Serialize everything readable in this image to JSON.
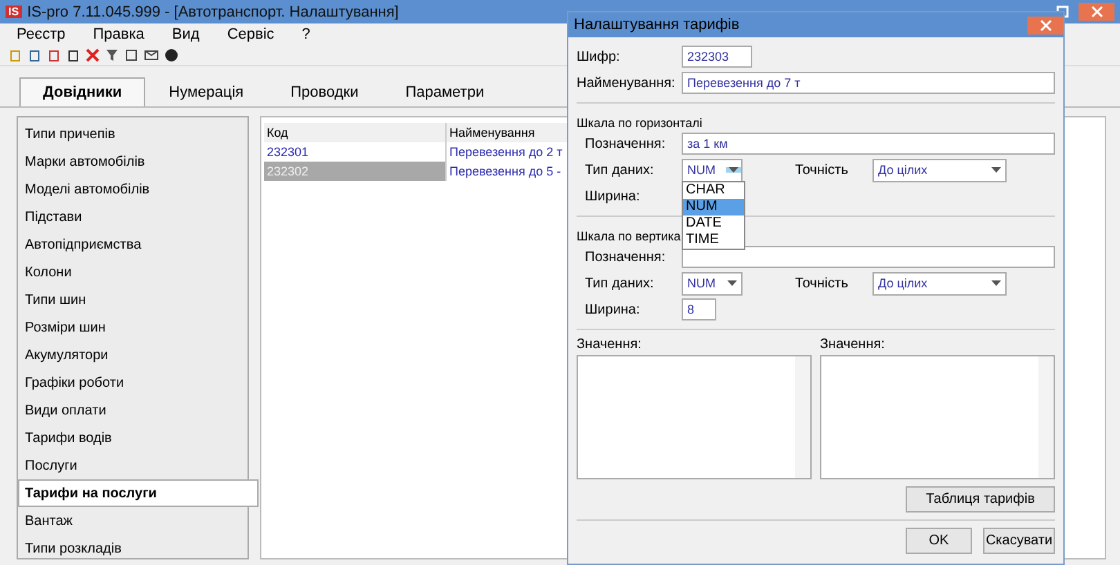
{
  "window": {
    "title": "IS-pro 7.11.045.999 - [Автотранспорт. Налаштування]",
    "logo": "IS"
  },
  "menu": [
    "Реєстр",
    "Правка",
    "Вид",
    "Сервіс",
    "?"
  ],
  "tabs": [
    {
      "label": "Довідники",
      "selected": true
    },
    {
      "label": "Нумерація",
      "selected": false
    },
    {
      "label": "Проводки",
      "selected": false
    },
    {
      "label": "Параметри",
      "selected": false
    }
  ],
  "sidebar": {
    "items": [
      {
        "label": "Типи причепів",
        "selected": false
      },
      {
        "label": "Марки автомобілів",
        "selected": false
      },
      {
        "label": "Моделі автомобілів",
        "selected": false
      },
      {
        "label": "Підстави",
        "selected": false
      },
      {
        "label": "Автопідприємства",
        "selected": false
      },
      {
        "label": "Колони",
        "selected": false
      },
      {
        "label": "Типи шин",
        "selected": false
      },
      {
        "label": "Розміри шин",
        "selected": false
      },
      {
        "label": "Акумулятори",
        "selected": false
      },
      {
        "label": "Графіки роботи",
        "selected": false
      },
      {
        "label": "Види оплати",
        "selected": false
      },
      {
        "label": "Тарифи водів",
        "selected": false
      },
      {
        "label": "Послуги",
        "selected": false
      },
      {
        "label": "Тарифи на послуги",
        "selected": true
      },
      {
        "label": "Вантаж",
        "selected": false
      },
      {
        "label": "Типи розкладів",
        "selected": false
      }
    ]
  },
  "table": {
    "columns": [
      "Код",
      "Найменування"
    ],
    "rows": [
      {
        "cells": [
          "232301",
          "Перевезення до 2 т"
        ],
        "selected": false
      },
      {
        "cells": [
          "232302",
          "Перевезення  до 5 -"
        ],
        "selected": true
      }
    ]
  },
  "dialog": {
    "title": "Налаштування тарифів",
    "code": {
      "label": "Шифр:",
      "value": "232303"
    },
    "name": {
      "label": "Найменування:",
      "value": "Перевезення до 7 т"
    },
    "horizontal": {
      "title": "Шкала по горизонталі",
      "designation": {
        "label": "Позначення:",
        "value": "за 1 км"
      },
      "type": {
        "label": "Тип даних:",
        "value": "NUM"
      },
      "precision": {
        "label": "Точність",
        "value": "До цілих"
      },
      "width": {
        "label": "Ширина:"
      }
    },
    "dropdown": [
      {
        "label": "CHAR",
        "selected": false
      },
      {
        "label": "NUM",
        "selected": true
      },
      {
        "label": "DATE",
        "selected": false
      },
      {
        "label": "TIME",
        "selected": false
      }
    ],
    "vertical": {
      "title": "Шкала по вертика",
      "designation": {
        "label": "Позначення:"
      },
      "type": {
        "label": "Тип даних:",
        "value": "NUM"
      },
      "precision": {
        "label": "Точність",
        "value": "До цілих"
      },
      "width": {
        "label": "Ширина:",
        "value": "8"
      }
    },
    "values": [
      {
        "label": "Значення:"
      },
      {
        "label": "Значення:"
      }
    ],
    "table_button": "Таблиця тарифів",
    "buttons": [
      "OK",
      "Скасувати"
    ]
  }
}
